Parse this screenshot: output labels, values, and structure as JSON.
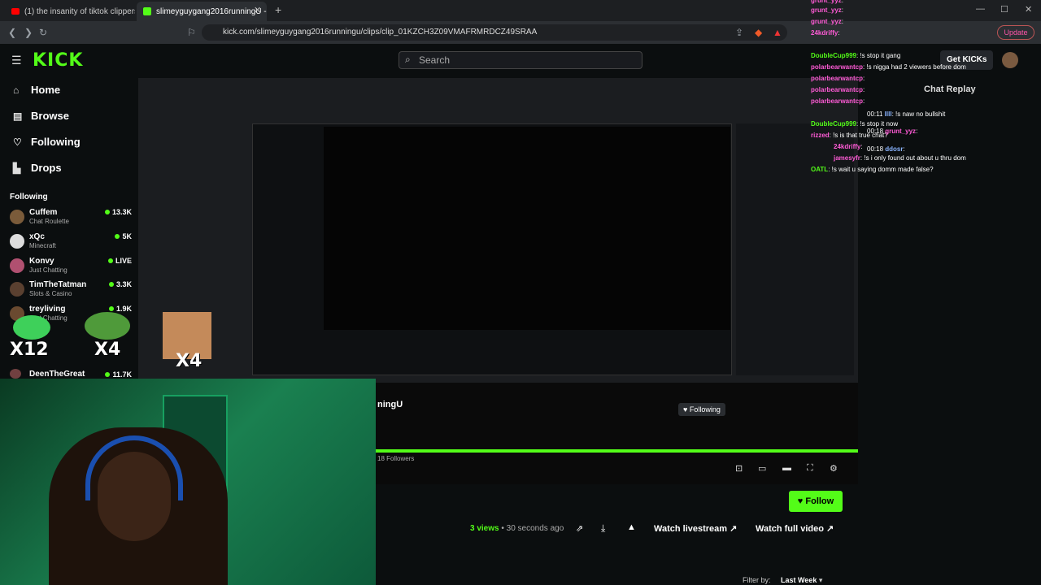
{
  "tabs": [
    {
      "title": "(1) the insanity of tiktok clippers 💔"
    },
    {
      "title": "slimeyguygang2016runningU - "
    }
  ],
  "address": {
    "url": "kick.com/slimeyguygang2016runningu/clips/clip_01KZCH3Z09VMAFRMRDCZ49SRAA",
    "update_label": "Update"
  },
  "header": {
    "logo": "KICK",
    "search_placeholder": "Search",
    "get_kicks": "Get KICKs",
    "chat_replay": "Chat Replay"
  },
  "sidebar": {
    "nav": [
      {
        "label": "Home",
        "icon": "home-icon"
      },
      {
        "label": "Browse",
        "icon": "browse-icon"
      },
      {
        "label": "Following",
        "icon": "heart-icon"
      },
      {
        "label": "Drops",
        "icon": "drops-icon"
      }
    ],
    "following_title": "Following",
    "following": [
      {
        "name": "Cuffem",
        "category": "Chat Roulette",
        "viewers": "13.3K",
        "color": "#7a5b3a"
      },
      {
        "name": "xQc",
        "category": "Minecraft",
        "viewers": "5K",
        "color": "#dddddd"
      },
      {
        "name": "Konvy",
        "category": "Just Chatting",
        "viewers": "LIVE",
        "color": "#b05070"
      },
      {
        "name": "TimTheTatman",
        "category": "Slots & Casino",
        "viewers": "3.3K",
        "color": "#5a4030"
      },
      {
        "name": "treyliving",
        "category": "Just Chatting",
        "viewers": "1.9K",
        "color": "#6a4a30"
      },
      {
        "name": "DeenTheGreat",
        "category": "",
        "viewers": "11.7K",
        "color": "#704040"
      }
    ]
  },
  "chat": [
    {
      "user": "grunt_yyz",
      "text": ":",
      "cls": "u-pink"
    },
    {
      "user": "grunt_yyz",
      "text": ":",
      "cls": "u-pink"
    },
    {
      "user": "grunt_yyz",
      "text": ":",
      "cls": "u-pink"
    },
    {
      "user": "24kdriffy",
      "text": ":",
      "cls": "u-pink"
    },
    {
      "user": "DoubleCup999",
      "text": ": !s stop it gang",
      "cls": "u-green"
    },
    {
      "user": "polarbearwantcp",
      "text": ": !s nigga had 2 viewers before dom",
      "cls": "u-pink"
    },
    {
      "user": "polarbearwantcp",
      "text": ":",
      "cls": "u-pink"
    },
    {
      "user": "polarbearwantcp",
      "text": ":",
      "cls": "u-pink"
    },
    {
      "user": "polarbearwantcp",
      "text": ":",
      "cls": "u-pink"
    },
    {
      "user": "DoubleCup999",
      "text": ": !s stop it now",
      "cls": "u-green"
    },
    {
      "user": "rizzed",
      "text": ": !s is that true chat?",
      "cls": "u-pink"
    },
    {
      "user": "24kdriffy",
      "text": ":",
      "cls": "u-pink"
    },
    {
      "user": "jamesyfr",
      "text": ": !s i only found out about u thru dom",
      "cls": "u-pink"
    },
    {
      "user": "OATL",
      "text": ": !s wait u saying domm made false?",
      "cls": "u-green"
    }
  ],
  "replay_lines": [
    {
      "time": "00:11",
      "user": "llll",
      "text": ": !s naw no bullshit"
    },
    {
      "time": "00:18",
      "user": "grunt_yyz",
      "text": ":"
    },
    {
      "time": "00:18",
      "user": "ddosr",
      "text": ":"
    }
  ],
  "clip": {
    "streamer_name": "ningU",
    "followers": "18 Followers",
    "following_label": "Following",
    "follow_label": "Follow",
    "views": "3 views",
    "posted": "• 30 seconds ago",
    "watch_livestream": "Watch livestream",
    "watch_full": "Watch full video",
    "filter_label": "Filter by:",
    "filter_value": "Last Week"
  },
  "emotes": [
    "X12",
    "X4",
    "X4"
  ],
  "colors": {
    "accent": "#53fc18",
    "bg": "#0b0e0f"
  }
}
